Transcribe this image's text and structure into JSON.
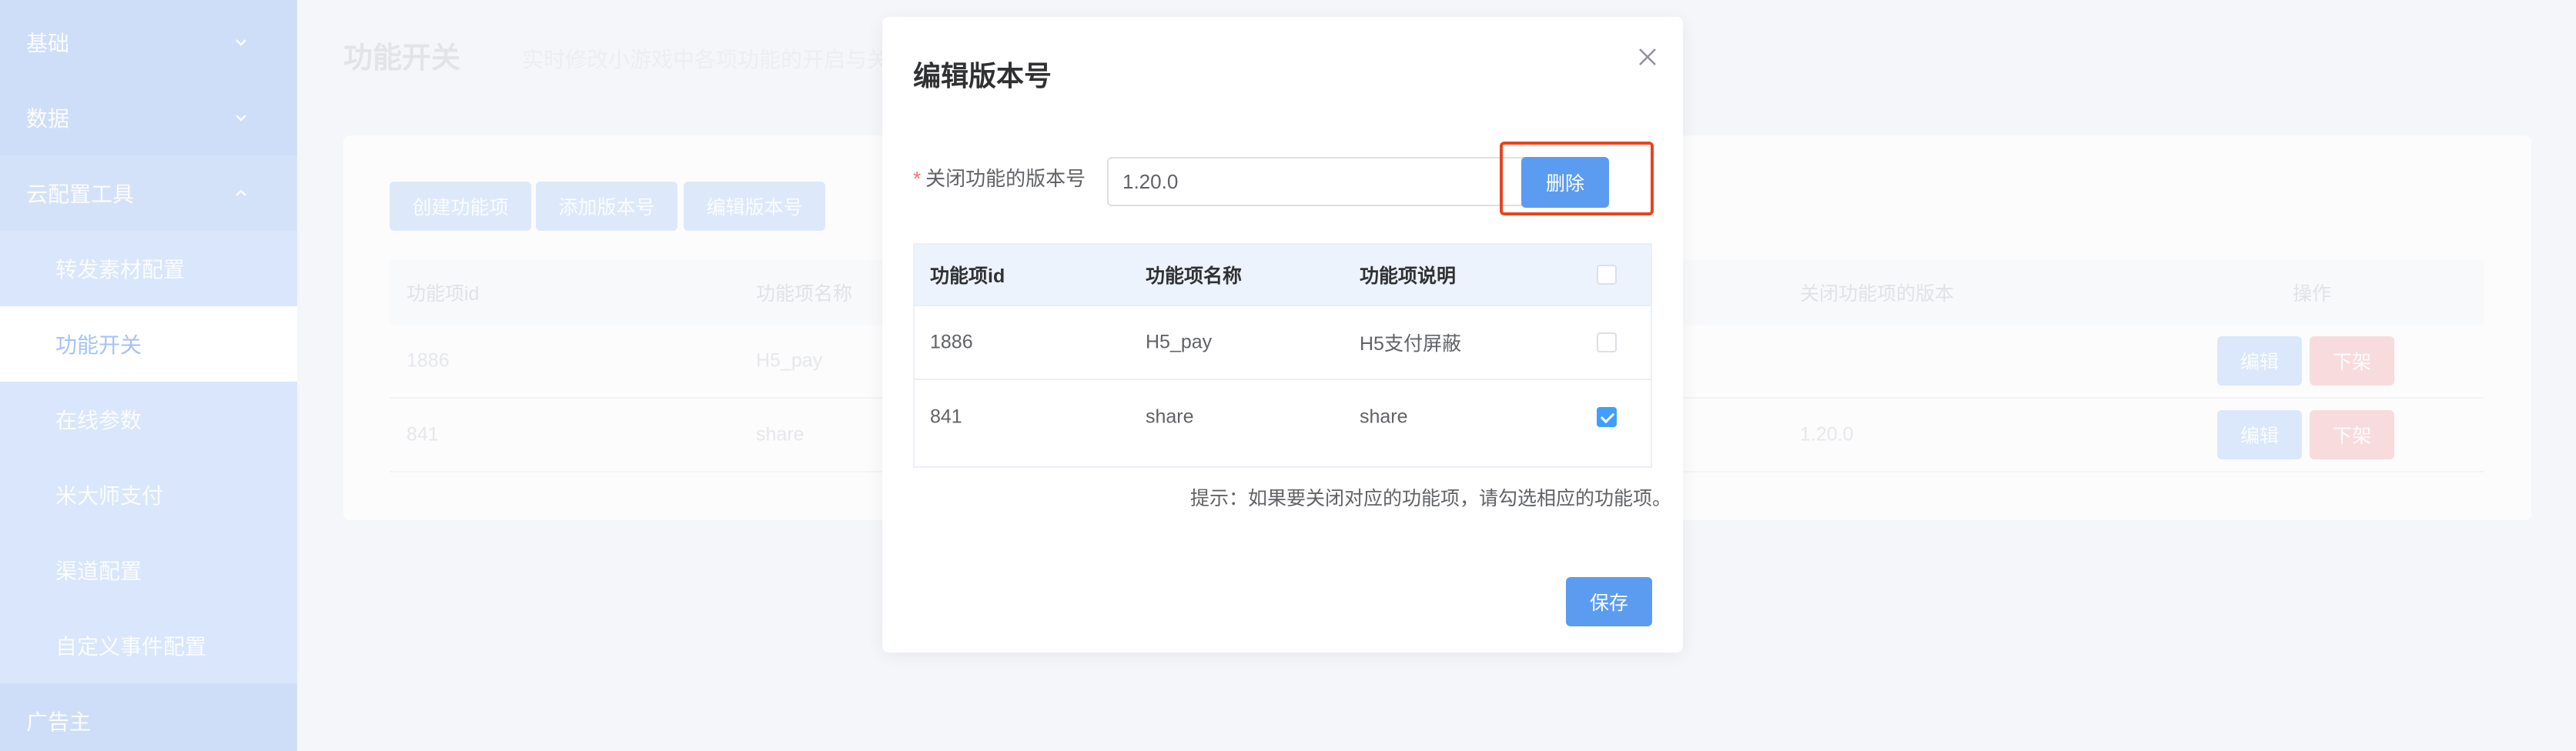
{
  "sidebar": {
    "items": [
      {
        "label": "基础"
      },
      {
        "label": "数据"
      },
      {
        "label": "云配置工具"
      },
      {
        "label": "转发素材配置"
      },
      {
        "label": "功能开关"
      },
      {
        "label": "在线参数"
      },
      {
        "label": "米大师支付"
      },
      {
        "label": "渠道配置"
      },
      {
        "label": "自定义事件配置"
      },
      {
        "label": "广告主"
      }
    ]
  },
  "page": {
    "title": "功能开关",
    "subtitle": "实时修改小游戏中各项功能的开启与关"
  },
  "toolbar": {
    "create_label": "创建功能项",
    "add_version_label": "添加版本号",
    "edit_version_label": "编辑版本号"
  },
  "bg_table": {
    "headers": [
      "功能项id",
      "功能项名称",
      "关闭功能项的版本",
      "操作"
    ],
    "rows": [
      {
        "id": "1886",
        "name": "H5_pay",
        "version": ""
      },
      {
        "id": "841",
        "name": "share",
        "version": "1.20.0"
      }
    ],
    "edit_label": "编辑",
    "off_label": "下架"
  },
  "dialog": {
    "title": "编辑版本号",
    "form_label": "关闭功能的版本号",
    "required_mark": "*",
    "version_value": "1.20.0",
    "delete_label": "删除",
    "table": {
      "headers": [
        "功能项id",
        "功能项名称",
        "功能项说明"
      ],
      "rows": [
        {
          "id": "1886",
          "name": "H5_pay",
          "desc": "H5支付屏蔽",
          "checked": false
        },
        {
          "id": "841",
          "name": "share",
          "desc": "share",
          "checked": true
        }
      ]
    },
    "hint": "提示：如果要关闭对应的功能项，请勾选相应的功能项。",
    "save_label": "保存"
  }
}
